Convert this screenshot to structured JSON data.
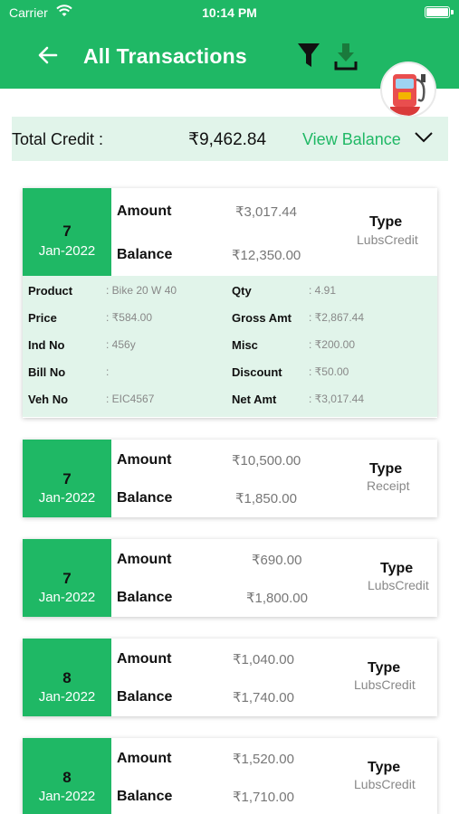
{
  "status": {
    "carrier": "Carrier",
    "time": "10:14 PM"
  },
  "header": {
    "title": "All Transactions"
  },
  "icons": {
    "back": "arrow-left",
    "filter": "filter-funnel",
    "download": "download-arrow",
    "avatar": "fuel-pump"
  },
  "summary": {
    "label": "Total Credit :",
    "value": "₹9,462.84",
    "link": "View Balance"
  },
  "labels": {
    "amount": "Amount",
    "balance": "Balance",
    "type": "Type"
  },
  "colors": {
    "primary": "#1fb865",
    "light_green": "#e1f4ea"
  },
  "transactions": [
    {
      "day": "7",
      "month": "Jan-2022",
      "amount": "₹3,017.44",
      "balance": "₹12,350.00",
      "type": "LubsCredit",
      "details": {
        "product_label": "Product",
        "product": ": Bike 20 W 40",
        "price_label": "Price",
        "price": ": ₹584.00",
        "ind_label": "Ind No",
        "ind": ": 456y",
        "bill_label": "Bill No",
        "bill": ":",
        "veh_label": "Veh No",
        "veh": ": EIC4567",
        "qty_label": "Qty",
        "qty": ": 4.91",
        "gross_label": "Gross Amt",
        "gross": ": ₹2,867.44",
        "misc_label": "Misc",
        "misc": ": ₹200.00",
        "discount_label": "Discount",
        "discount": ": ₹50.00",
        "net_label": "Net Amt",
        "net": ": ₹3,017.44"
      }
    },
    {
      "day": "7",
      "month": "Jan-2022",
      "amount": "₹10,500.00",
      "balance": "₹1,850.00",
      "type": "Receipt"
    },
    {
      "day": "7",
      "month": "Jan-2022",
      "amount": "₹690.00",
      "balance": "₹1,800.00",
      "type": "LubsCredit"
    },
    {
      "day": "8",
      "month": "Jan-2022",
      "amount": "₹1,040.00",
      "balance": "₹1,740.00",
      "type": "LubsCredit"
    },
    {
      "day": "8",
      "month": "Jan-2022",
      "amount": "₹1,520.00",
      "balance": "₹1,710.00",
      "type": "LubsCredit"
    }
  ]
}
